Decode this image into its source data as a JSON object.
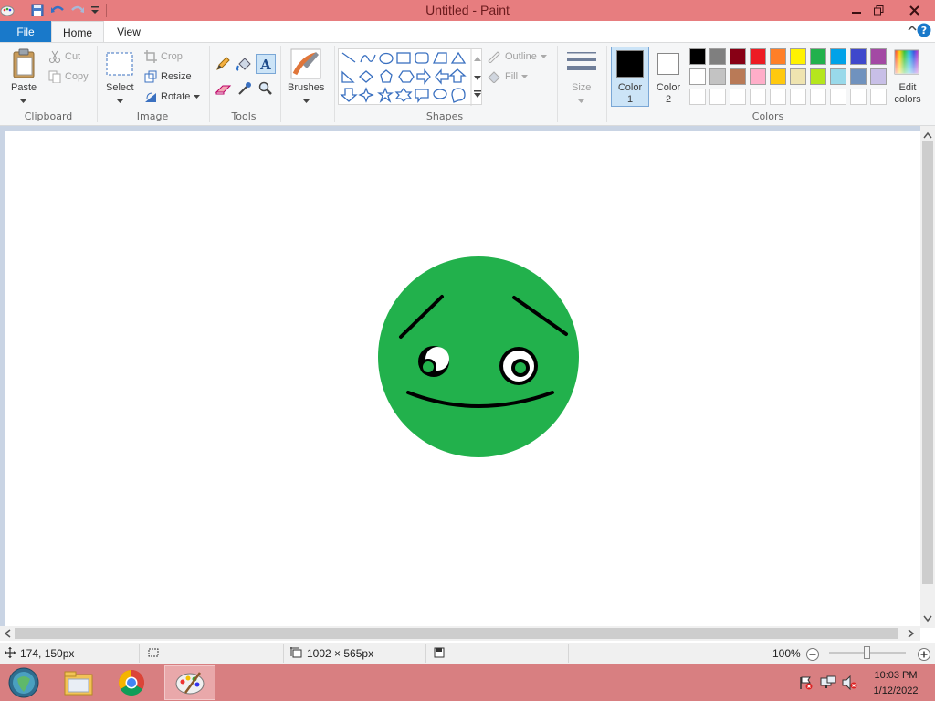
{
  "window": {
    "title": "Untitled - Paint"
  },
  "tabs": {
    "file": "File",
    "home": "Home",
    "view": "View"
  },
  "clipboard": {
    "paste": "Paste",
    "cut": "Cut",
    "copy": "Copy",
    "label": "Clipboard"
  },
  "image": {
    "select": "Select",
    "crop": "Crop",
    "resize": "Resize",
    "rotate": "Rotate",
    "label": "Image"
  },
  "tools": {
    "label": "Tools"
  },
  "brushes": {
    "label": "Brushes"
  },
  "shapes": {
    "outline": "Outline",
    "fill": "Fill",
    "label": "Shapes"
  },
  "size": {
    "label": "Size"
  },
  "colors": {
    "color1": "Color 1",
    "color2": "Color 2",
    "edit": "Edit colors",
    "label": "Colors",
    "color1_value": "#000000",
    "color2_value": "#ffffff",
    "palette_row1": [
      "#000000",
      "#7f7f7f",
      "#880015",
      "#ed1c24",
      "#ff7f27",
      "#fff200",
      "#22b14c",
      "#00a2e8",
      "#3f48cc",
      "#a349a4"
    ],
    "palette_row2": [
      "#ffffff",
      "#c3c3c3",
      "#b97a57",
      "#ffaec9",
      "#ffc90e",
      "#efe4b0",
      "#b5e61d",
      "#99d9ea",
      "#7092be",
      "#c8bfe7"
    ]
  },
  "drawing": {
    "face_color": "#22b14c",
    "stroke_color": "#000000"
  },
  "status": {
    "cursor_pos": "174, 150px",
    "canvas_size": "1002 × 565px",
    "zoom": "100%"
  },
  "taskbar": {
    "time": "10:03 PM",
    "date": "1/12/2022"
  }
}
